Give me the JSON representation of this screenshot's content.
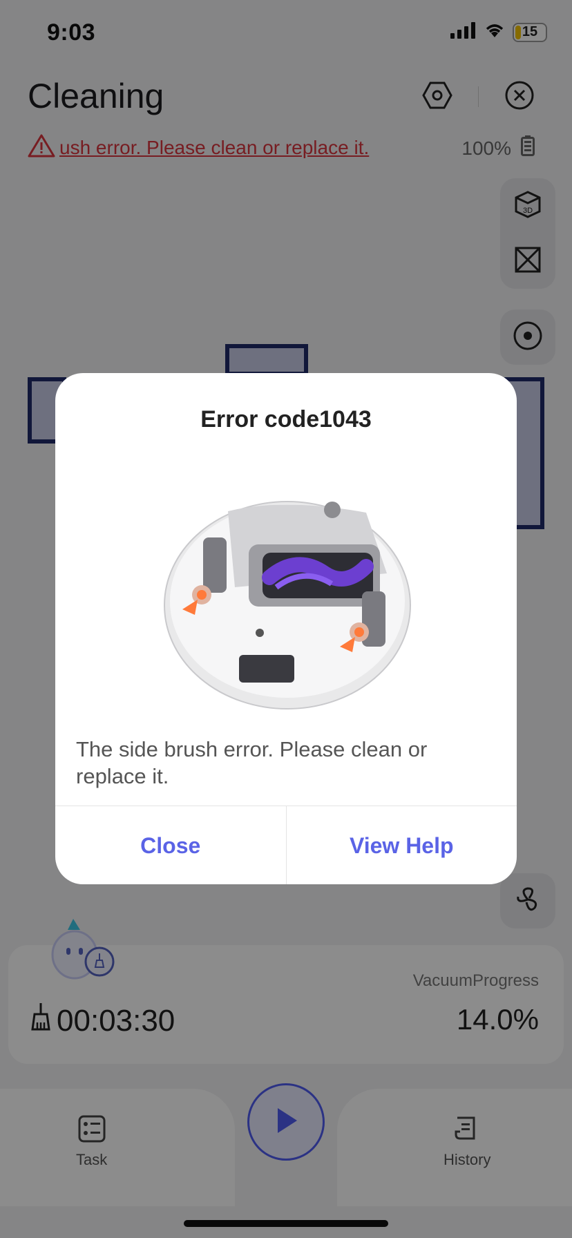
{
  "status": {
    "time": "9:03",
    "battery": "15"
  },
  "header": {
    "title": "Cleaning",
    "error_text": "ush error. Please clean or replace it.",
    "battery_pct": "100%"
  },
  "side_buttons": [
    "3d-view-icon",
    "map-edit-icon",
    "target-icon",
    "fan-icon"
  ],
  "bottom": {
    "vacuum_label": "VacuumProgress",
    "vacuum_value": "14.0%",
    "timer": "00:03:30"
  },
  "tabs": {
    "task": "Task",
    "history": "History"
  },
  "dialog": {
    "title": "Error code1043",
    "message": "The side brush error. Please clean or replace it.",
    "close": "Close",
    "view_help": "View Help"
  },
  "colors": {
    "accent": "#5a63e6",
    "error": "#d9363e",
    "map_wall": "#1f2b6a"
  }
}
